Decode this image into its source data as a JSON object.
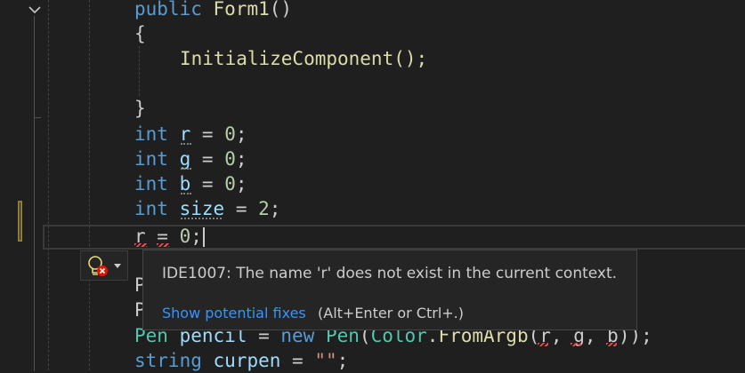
{
  "editor": {
    "lines": {
      "constructor": {
        "kw": "public",
        "name": "Form1",
        "parens": "()"
      },
      "open_brace": "{",
      "init_call": "InitializeComponent();",
      "close_brace": "}",
      "decl_r": {
        "kw": "int",
        "var": "r",
        "eq": " = ",
        "val": "0",
        "end": ";"
      },
      "decl_g": {
        "kw": "int",
        "var": "g",
        "eq": " = ",
        "val": "0",
        "end": ";"
      },
      "decl_b": {
        "kw": "int",
        "var": "b",
        "eq": " = ",
        "val": "0",
        "end": ";"
      },
      "decl_size": {
        "kw": "int",
        "var": "size",
        "eq": " = ",
        "val": "2",
        "end": ";"
      },
      "assign_r": {
        "var": "r",
        "eq": " = ",
        "val": "0",
        "end": ";"
      },
      "hidden_p1": "P",
      "hidden_p2": "P",
      "pen_line": {
        "type": "Pen",
        "var": "pencil",
        "eq": " = ",
        "kw": "new",
        "ctor": "Pen",
        "open": "(",
        "cls": "Color",
        "dot": ".",
        "method": "FromArgb",
        "args_open": "(",
        "a1": "r",
        ",": ", ",
        "a2": "g",
        "a3": "b",
        "close": "));"
      },
      "curpen_line": {
        "kw": "string",
        "var": "curpen",
        "eq": " = ",
        "val": "\"\"",
        "end": ";"
      }
    }
  },
  "tooltip": {
    "message": "IDE1007: The name 'r' does not exist in the current context.",
    "link": "Show potential fixes",
    "shortcut": "(Alt+Enter or Ctrl+.)"
  },
  "icons": {
    "fold": "chevron-down-icon",
    "lightbulb": "lightbulb-error-icon",
    "dropdown": "dropdown-arrow-icon"
  },
  "colors": {
    "background": "#1f1f1f",
    "keyword": "#569cd6",
    "type": "#4ec9b0",
    "method": "#dcdcaa",
    "number": "#b5cea8",
    "string": "#ce9178",
    "link": "#3794ff",
    "error": "#f14c4c"
  }
}
